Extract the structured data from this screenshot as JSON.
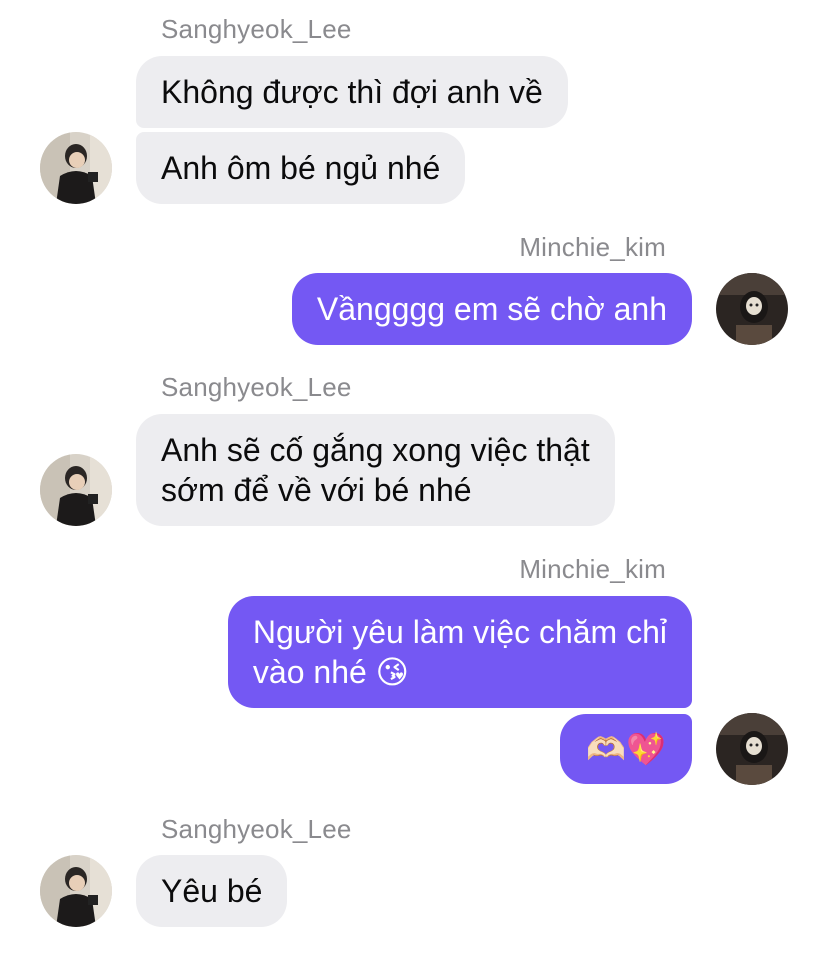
{
  "chat": {
    "messages": [
      {
        "sender": "Sanghyeok_Lee",
        "text": "Không được thì đợi anh về"
      },
      {
        "sender": "Sanghyeok_Lee",
        "text": "Anh ôm bé ngủ nhé"
      },
      {
        "sender": "Minchie_kim",
        "text": "Vầngggg em sẽ chờ anh"
      },
      {
        "sender": "Sanghyeok_Lee",
        "text": "Anh sẽ cố gắng xong việc thật\nsớm để về với bé nhé"
      },
      {
        "sender": "Minchie_kim",
        "text": "Người yêu làm việc chăm chỉ\nvào nhé 😘"
      },
      {
        "sender": "Minchie_kim",
        "text": "🫶🏻💖"
      },
      {
        "sender": "Sanghyeok_Lee",
        "text": "Yêu bé"
      }
    ]
  },
  "colors": {
    "incoming_bubble": "#ededf0",
    "outgoing_bubble": "#7458f3",
    "sender_name": "#8a8a8e"
  }
}
